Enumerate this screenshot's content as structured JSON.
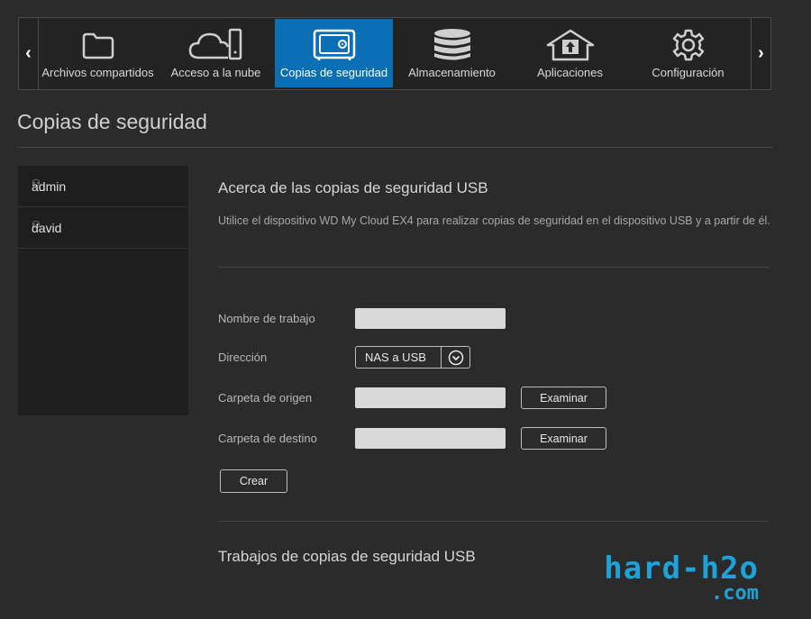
{
  "nav": {
    "prev_arrow": "‹",
    "next_arrow": "›",
    "items": [
      {
        "label": "Archivos compartidos",
        "icon": "folder-icon"
      },
      {
        "label": "Acceso a la nube",
        "icon": "cloud-device-icon"
      },
      {
        "label": "Copias de seguridad",
        "icon": "safe-icon",
        "active": true
      },
      {
        "label": "Almacenamiento",
        "icon": "database-icon"
      },
      {
        "label": "Aplicaciones",
        "icon": "upload-house-icon"
      },
      {
        "label": "Configuración",
        "icon": "gear-icon"
      }
    ],
    "active_color": "#0a6fb4"
  },
  "page": {
    "title": "Copias de seguridad"
  },
  "sidebar": {
    "users": [
      {
        "name": "admin",
        "icon": "user-icon"
      },
      {
        "name": "david",
        "icon": "user-icon"
      }
    ]
  },
  "about": {
    "title": "Acerca de las copias de seguridad USB",
    "description": "Utilice el dispositivo WD My Cloud EX4 para realizar copias de seguridad en el dispositivo USB y a partir de él."
  },
  "form": {
    "job_name_label": "Nombre de trabajo",
    "job_name_value": "",
    "direction_label": "Dirección",
    "direction_value": "NAS a USB",
    "source_label": "Carpeta de origen",
    "source_value": "",
    "dest_label": "Carpeta de destino",
    "dest_value": "",
    "browse_label": "Examinar",
    "create_label": "Crear"
  },
  "jobs": {
    "title": "Trabajos de copias de seguridad USB"
  },
  "watermark": {
    "line1": "hard-h2o",
    "line2": ".com",
    "color": "#1ea2d8"
  }
}
